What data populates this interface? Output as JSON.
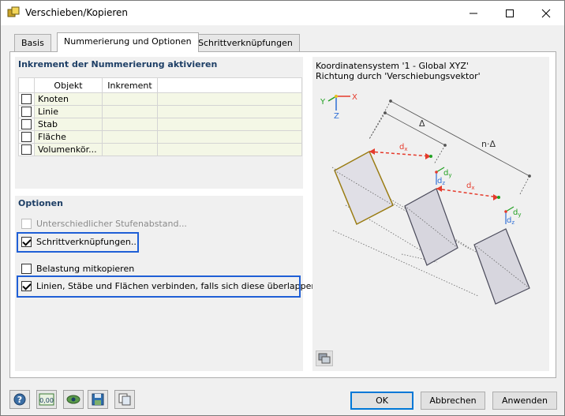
{
  "window": {
    "title": "Verschieben/Kopieren"
  },
  "tabs": [
    {
      "label": "Basis",
      "active": false
    },
    {
      "label": "Nummerierung und Optionen",
      "active": true
    },
    {
      "label": "Schrittverknüpfungen",
      "active": false
    }
  ],
  "increment": {
    "title": "Inkrement der Nummerierung aktivieren",
    "columns": [
      "Objekt",
      "Inkrement"
    ],
    "rows": [
      {
        "label": "Knoten",
        "checked": false
      },
      {
        "label": "Linie",
        "checked": false
      },
      {
        "label": "Stab",
        "checked": false
      },
      {
        "label": "Fläche",
        "checked": false
      },
      {
        "label": "Volumenkör...",
        "checked": false
      }
    ]
  },
  "options": {
    "title": "Optionen",
    "items": [
      {
        "label": "Unterschiedlicher Stufenabstand...",
        "checked": false,
        "disabled": true
      },
      {
        "label": "Schrittverknüpfungen...",
        "checked": true,
        "disabled": false
      },
      {
        "label": "Belastung mitkopieren",
        "checked": false,
        "disabled": false
      },
      {
        "label": "Linien, Stäbe und Flächen verbinden, falls sich diese überlappen",
        "checked": true,
        "disabled": false
      }
    ]
  },
  "preview": {
    "line1": "Koordinatensystem '1 - Global XYZ'",
    "line2": "Richtung durch 'Verschiebungsvektor'",
    "axis_x": "X",
    "axis_y": "Y",
    "axis_z": "Z",
    "dim_delta": "Δ",
    "dim_n_delta": "n·Δ",
    "dx": "d",
    "dx_sub": "x",
    "dy": "d",
    "dy_sub": "y",
    "dz": "d",
    "dz_sub": "z"
  },
  "buttons": {
    "ok": "OK",
    "cancel": "Abbrechen",
    "apply": "Anwenden"
  },
  "colors": {
    "accent": "#1f5fd6",
    "group_title": "#1e3f66",
    "vector": "#e53b2c"
  }
}
